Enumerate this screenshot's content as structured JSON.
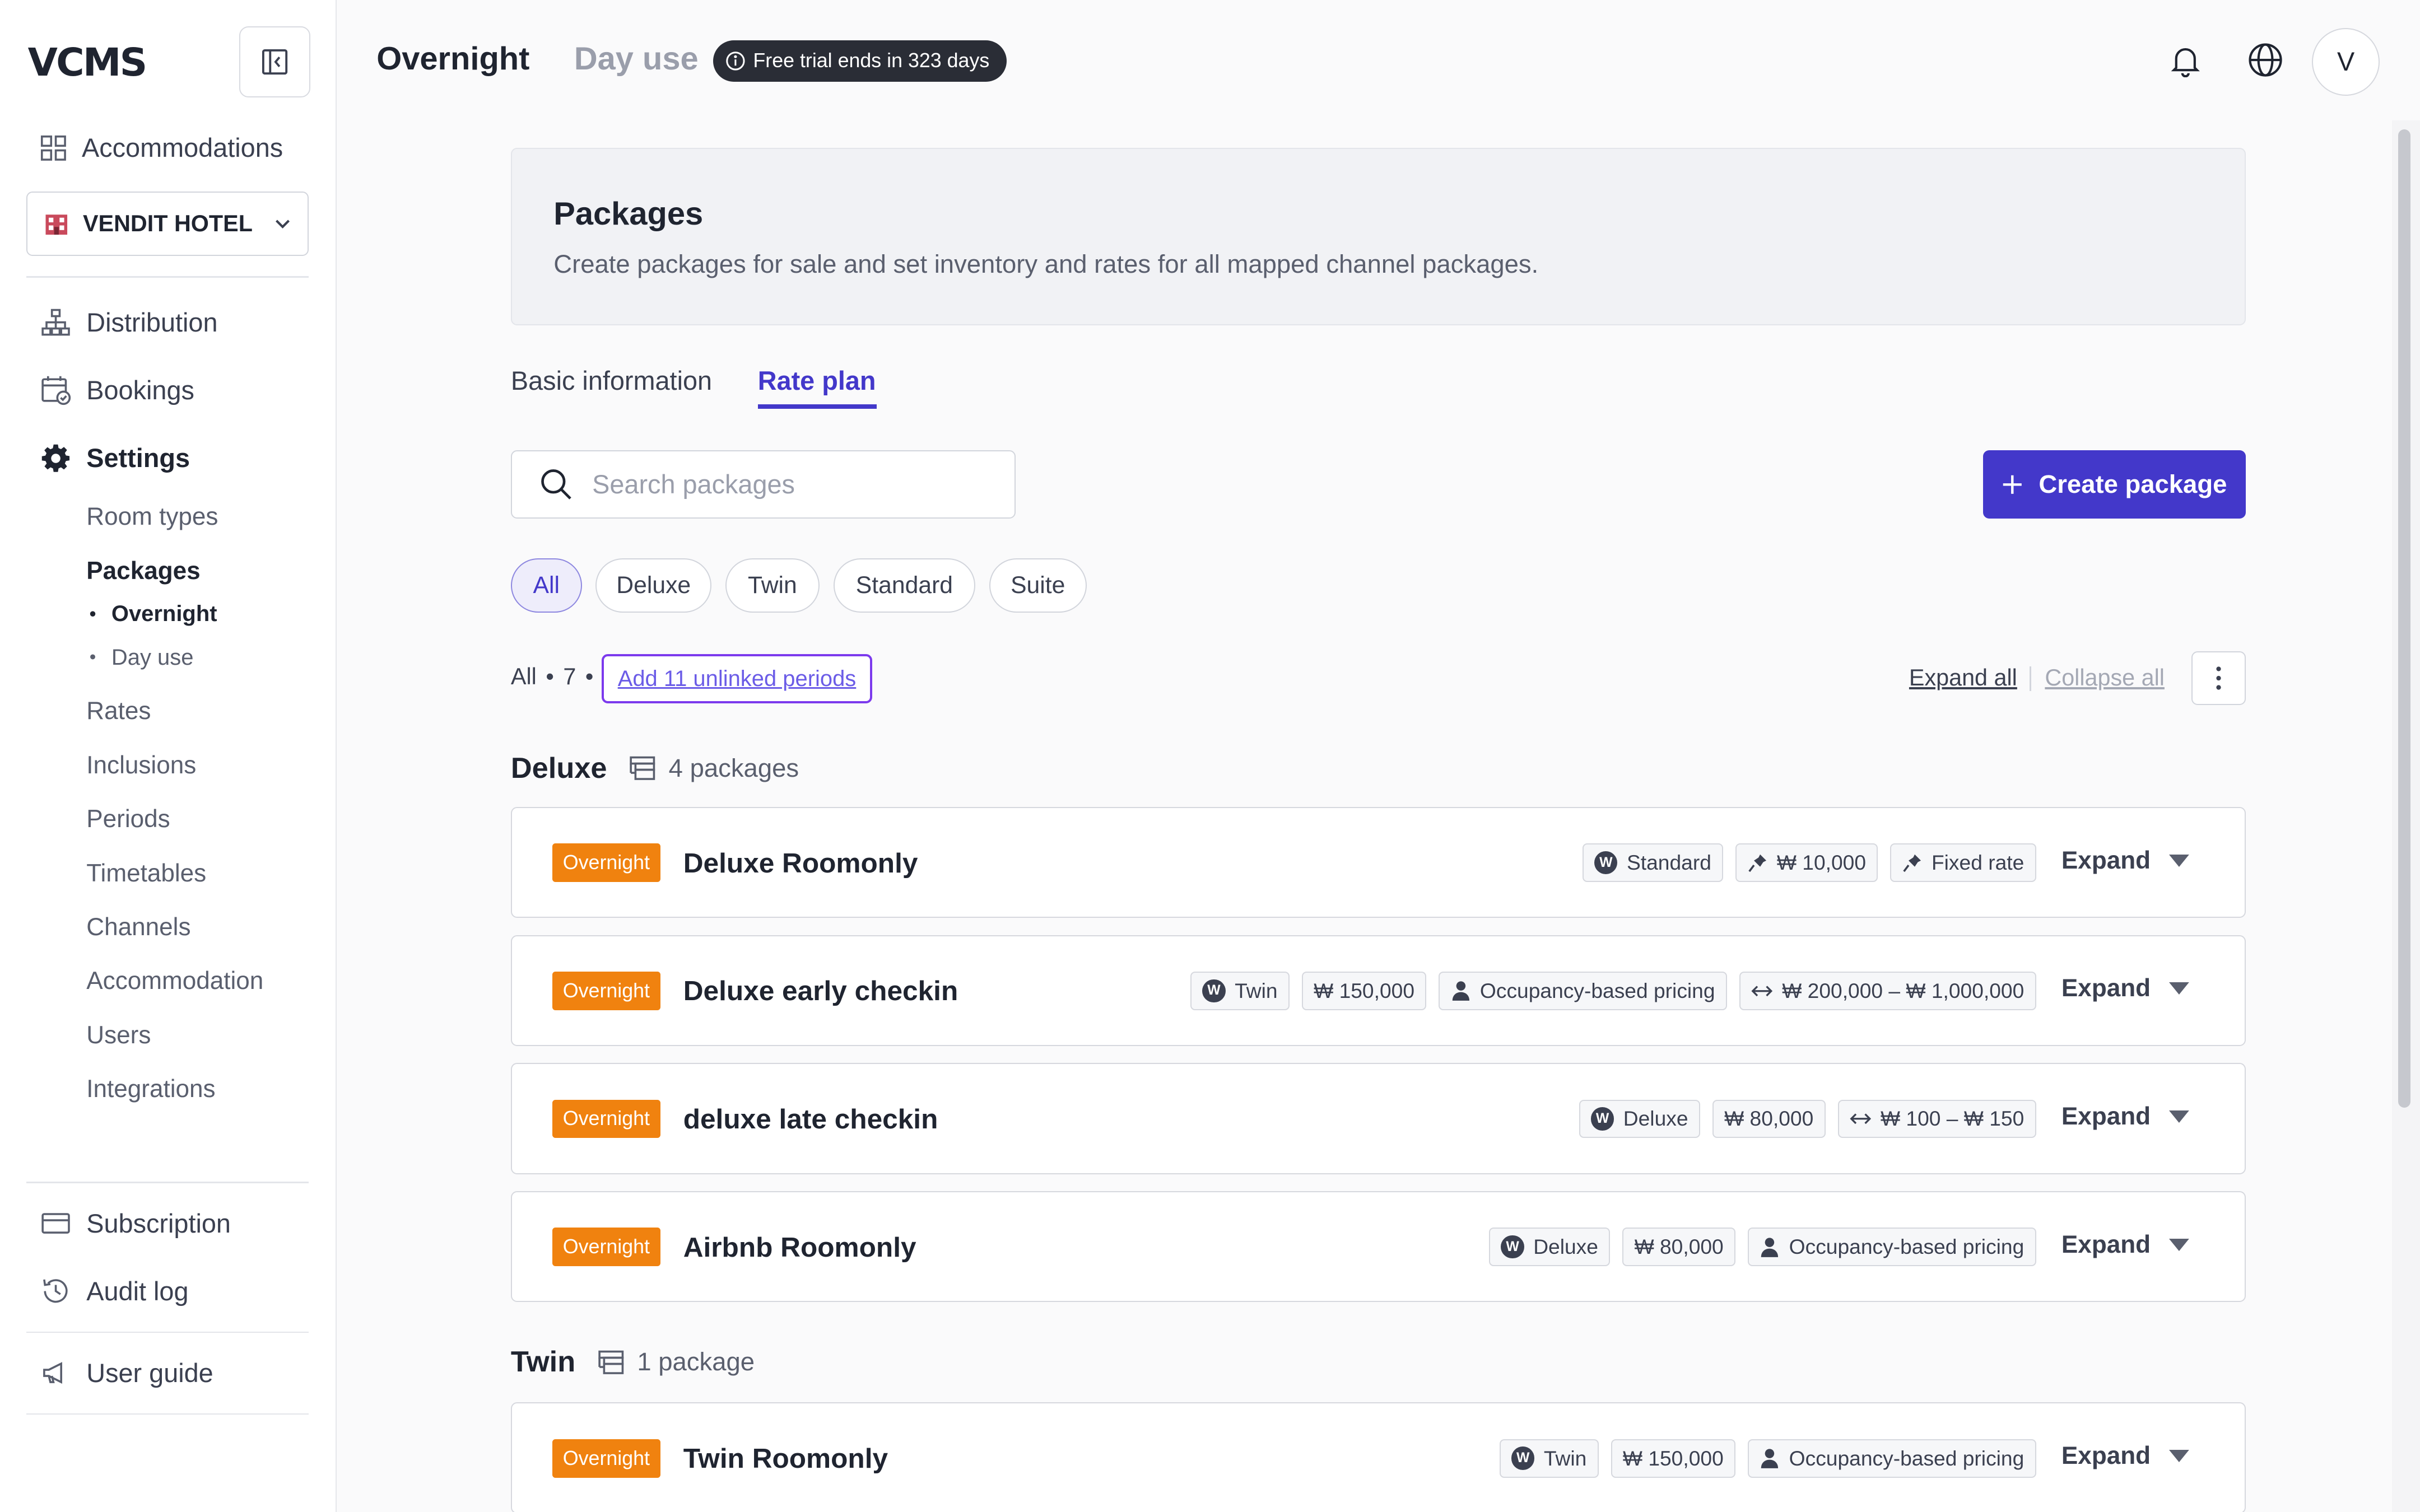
{
  "sidebar": {
    "logo": "VCMS",
    "accommodations": "Accommodations",
    "hotel": "VENDIT HOTEL",
    "distribution": "Distribution",
    "bookings": "Bookings",
    "settings": "Settings",
    "settings_items": {
      "room_types": "Room types",
      "packages": "Packages",
      "overnight": "Overnight",
      "day_use": "Day use",
      "rates": "Rates",
      "inclusions": "Inclusions",
      "periods": "Periods",
      "timetables": "Timetables",
      "channels": "Channels",
      "accommodation": "Accommodation",
      "users": "Users",
      "integrations": "Integrations"
    },
    "subscription": "Subscription",
    "audit_log": "Audit log",
    "user_guide": "User guide"
  },
  "topbar": {
    "tab_overnight": "Overnight",
    "tab_day_use": "Day use",
    "trial_badge": "Free trial ends in 323 days",
    "avatar": "V"
  },
  "header": {
    "title": "Packages",
    "description": "Create packages for sale and set inventory and rates for all mapped channel packages."
  },
  "tabs": {
    "basic": "Basic information",
    "rate_plan": "Rate plan"
  },
  "search": {
    "placeholder": "Search packages"
  },
  "create_button": "Create package",
  "filters": [
    "All",
    "Deluxe",
    "Twin",
    "Standard",
    "Suite"
  ],
  "summary": {
    "all": "All",
    "count": "7",
    "unlinked": "Add 11 unlinked periods",
    "expand_all": "Expand all",
    "collapse_all": "Collapse all"
  },
  "groups": {
    "deluxe": {
      "name": "Deluxe",
      "count": "4 packages"
    },
    "twin": {
      "name": "Twin",
      "count": "1 package"
    }
  },
  "packages": [
    {
      "badge": "Overnight",
      "name": "Deluxe Roomonly",
      "tags": [
        "Standard",
        "₩ 10,000",
        "Fixed rate"
      ],
      "expand": "Expand"
    },
    {
      "badge": "Overnight",
      "name": "Deluxe early checkin",
      "tags": [
        "Twin",
        "₩ 150,000",
        "Occupancy-based pricing",
        "₩ 200,000 – ₩ 1,000,000"
      ],
      "expand": "Expand"
    },
    {
      "badge": "Overnight",
      "name": "deluxe late checkin",
      "tags": [
        "Deluxe",
        "₩ 80,000",
        "₩ 100 – ₩ 150"
      ],
      "expand": "Expand"
    },
    {
      "badge": "Overnight",
      "name": "Airbnb Roomonly",
      "tags": [
        "Deluxe",
        "₩ 80,000",
        "Occupancy-based pricing"
      ],
      "expand": "Expand"
    },
    {
      "badge": "Overnight",
      "name": "Twin Roomonly",
      "tags": [
        "Twin",
        "₩ 150,000",
        "Occupancy-based pricing"
      ],
      "expand": "Expand"
    }
  ],
  "colors": {
    "accent": "#4338ca",
    "badge_overnight": "#f0820f",
    "trial_badge_bg": "#2a2d36"
  }
}
